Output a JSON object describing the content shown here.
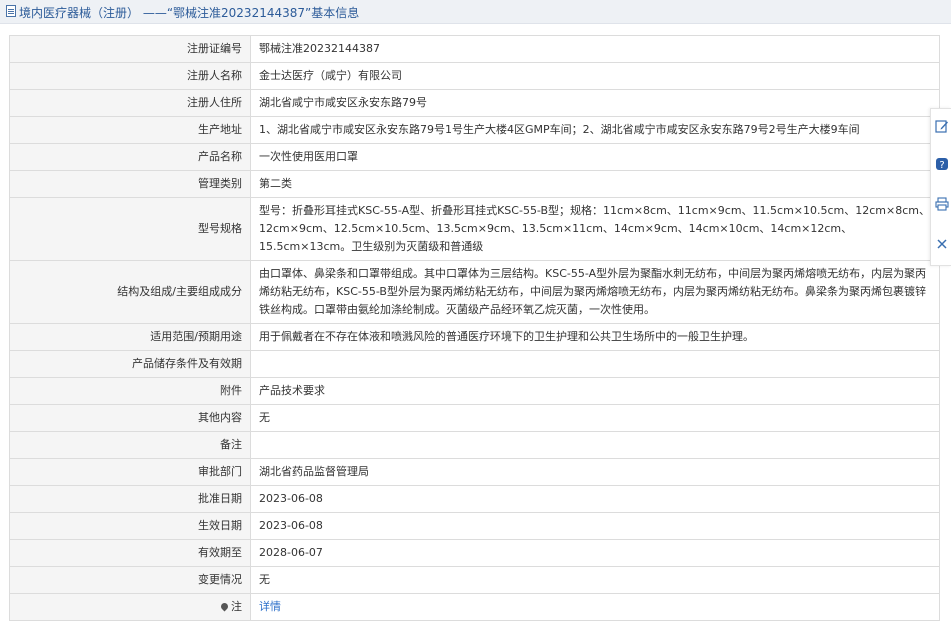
{
  "header": {
    "title": "境内医疗器械（注册） ——“鄂械注准20232144387”基本信息"
  },
  "rows": [
    {
      "label": "注册证编号",
      "value": "鄂械注准20232144387"
    },
    {
      "label": "注册人名称",
      "value": "金士达医疗（咸宁）有限公司"
    },
    {
      "label": "注册人住所",
      "value": "湖北省咸宁市咸安区永安东路79号"
    },
    {
      "label": "生产地址",
      "value": "1、湖北省咸宁市咸安区永安东路79号1号生产大楼4区GMP车间；2、湖北省咸宁市咸安区永安东路79号2号生产大楼9车间"
    },
    {
      "label": "产品名称",
      "value": "一次性使用医用口罩"
    },
    {
      "label": "管理类别",
      "value": "第二类"
    },
    {
      "label": "型号规格",
      "value": "型号：折叠形耳挂式KSC-55-A型、折叠形耳挂式KSC-55-B型；规格：11cm×8cm、11cm×9cm、11.5cm×10.5cm、12cm×8cm、12cm×9cm、12.5cm×10.5cm、13.5cm×9cm、13.5cm×11cm、14cm×9cm、14cm×10cm、14cm×12cm、15.5cm×13cm。卫生级别为灭菌级和普通级"
    },
    {
      "label": "结构及组成/主要组成成分",
      "value": "由口罩体、鼻梁条和口罩带组成。其中口罩体为三层结构。KSC-55-A型外层为聚酯水刺无纺布，中间层为聚丙烯熔喷无纺布，内层为聚丙烯纺粘无纺布，KSC-55-B型外层为聚丙烯纺粘无纺布，中间层为聚丙烯熔喷无纺布，内层为聚丙烯纺粘无纺布。鼻梁条为聚丙烯包裹镀锌铁丝构成。口罩带由氨纶加涤纶制成。灭菌级产品经环氧乙烷灭菌，一次性使用。"
    },
    {
      "label": "适用范围/预期用途",
      "value": "用于佩戴者在不存在体液和喷溅风险的普通医疗环境下的卫生护理和公共卫生场所中的一般卫生护理。"
    },
    {
      "label": "产品储存条件及有效期",
      "value": ""
    },
    {
      "label": "附件",
      "value": "产品技术要求"
    },
    {
      "label": "其他内容",
      "value": "无"
    },
    {
      "label": "备注",
      "value": ""
    },
    {
      "label": "审批部门",
      "value": "湖北省药品监督管理局"
    },
    {
      "label": "批准日期",
      "value": "2023-06-08"
    },
    {
      "label": "生效日期",
      "value": "2023-06-08"
    },
    {
      "label": "有效期至",
      "value": "2028-06-07"
    },
    {
      "label": "变更情况",
      "value": "无"
    }
  ],
  "note_row": {
    "label": "注",
    "link": "详情"
  },
  "toolbar": {
    "icons": [
      "edit-icon",
      "help-icon",
      "print-icon",
      "close-icon"
    ]
  }
}
